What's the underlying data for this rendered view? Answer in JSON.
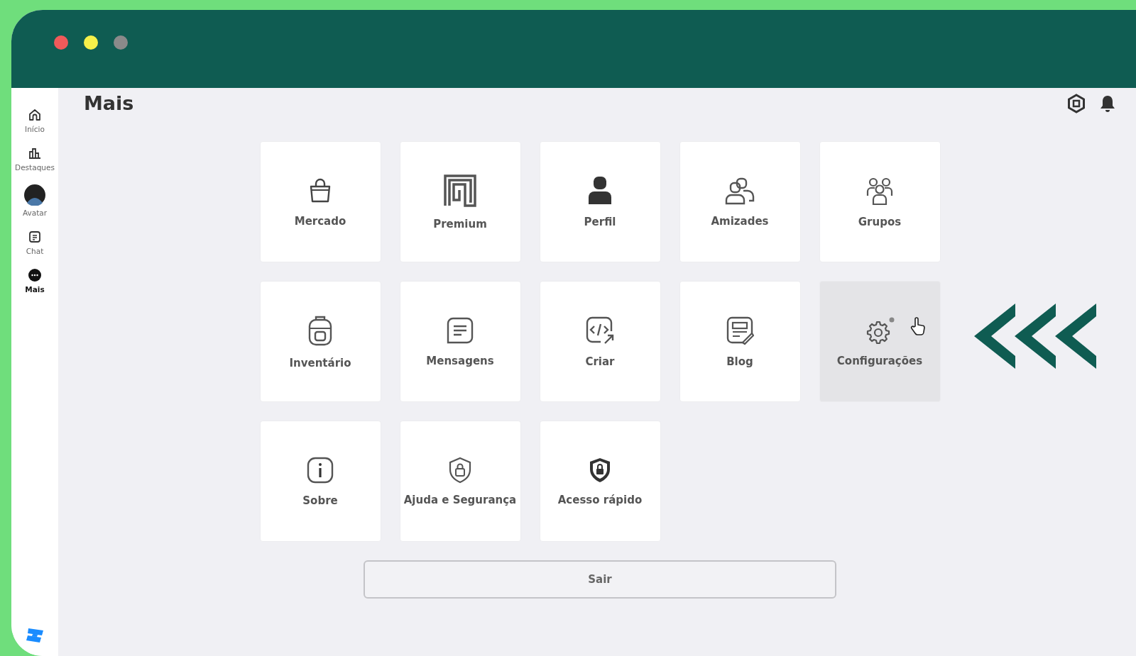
{
  "window": {
    "controls": [
      {
        "color": "#f05a5a"
      },
      {
        "color": "#f6f04a"
      },
      {
        "color": "#8a8a8a"
      }
    ]
  },
  "sidebar": {
    "items": [
      {
        "label": "Início",
        "selected": false
      },
      {
        "label": "Destaques",
        "selected": false
      },
      {
        "label": "Avatar",
        "selected": false
      },
      {
        "label": "Chat",
        "selected": false
      },
      {
        "label": "Mais",
        "selected": true
      }
    ]
  },
  "page": {
    "title": "Mais"
  },
  "tiles": [
    {
      "label": "Mercado",
      "selected": false
    },
    {
      "label": "Premium",
      "selected": false
    },
    {
      "label": "Perfil",
      "selected": false
    },
    {
      "label": "Amizades",
      "selected": false
    },
    {
      "label": "Grupos",
      "selected": false
    },
    {
      "label": "Inventário",
      "selected": false
    },
    {
      "label": "Mensagens",
      "selected": false
    },
    {
      "label": "Criar",
      "selected": false
    },
    {
      "label": "Blog",
      "selected": false
    },
    {
      "label": "Configurações",
      "selected": true
    },
    {
      "label": "Sobre",
      "selected": false
    },
    {
      "label": "Ajuda e Segurança",
      "selected": false
    },
    {
      "label": "Acesso rápido",
      "selected": false
    }
  ],
  "logout_button": {
    "label": "Sair"
  }
}
